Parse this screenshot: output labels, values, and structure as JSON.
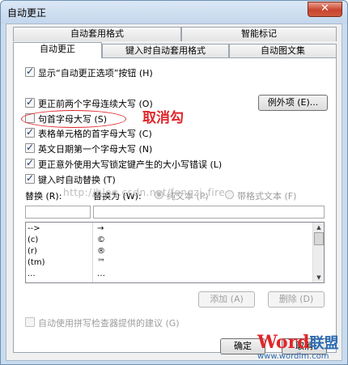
{
  "window": {
    "title": "自动更正",
    "close_glyph": "✕"
  },
  "tabs": {
    "row_back": [
      {
        "label": "自动套用格式"
      },
      {
        "label": "智能标记"
      }
    ],
    "row_front": [
      {
        "label": "自动更正",
        "active": true
      },
      {
        "label": "键入时自动套用格式"
      },
      {
        "label": "自动图文集"
      }
    ]
  },
  "options": {
    "show_buttons": {
      "label": "显示“自动更正选项”按钮 (H)",
      "checked": true
    },
    "two_initial_caps": {
      "label": "更正前两个字母连续大写 (O)",
      "checked": true
    },
    "first_letter_sentence": {
      "label": "句首字母大写 (S)",
      "checked": false
    },
    "first_letter_table": {
      "label": "表格单元格的首字母大写 (C)",
      "checked": true
    },
    "day_names": {
      "label": "英文日期第一个字母大写 (N)",
      "checked": true
    },
    "caps_lock": {
      "label": "更正意外使用大写锁定键产生的大小写错误 (L)",
      "checked": true
    },
    "replace_as_type": {
      "label": "键入时自动替换 (T)",
      "checked": true
    },
    "spell_suggest": {
      "label": "自动使用拼写检查器提供的建议 (G)",
      "checked": false
    }
  },
  "exceptions_button": "例外项 (E)...",
  "replace": {
    "replace_label": "替换 (R):",
    "with_label": "替换为 (W):",
    "plain_text": {
      "label": "纯文本 (P)",
      "selected": true
    },
    "formatted_text": {
      "label": "带格式文本 (F)",
      "selected": false
    },
    "replace_value": "",
    "with_value": "",
    "entries": [
      {
        "from": "-->",
        "to": "→"
      },
      {
        "from": "(c)",
        "to": "©"
      },
      {
        "from": "(r)",
        "to": "®"
      },
      {
        "from": "(tm)",
        "to": "™"
      },
      {
        "from": "...",
        "to": "…"
      }
    ]
  },
  "buttons": {
    "add": "添加 (A)",
    "delete": "删除 (D)",
    "ok": "确定",
    "cancel": "取消"
  },
  "annotation": {
    "text": "取消勾",
    "color": "#e0262a"
  },
  "watermark": {
    "text": "http://blog.csdn.net/fengzi_fire"
  },
  "logo": {
    "part1": "Word",
    "part2": "联盟",
    "url": "www.wordlm.com"
  }
}
